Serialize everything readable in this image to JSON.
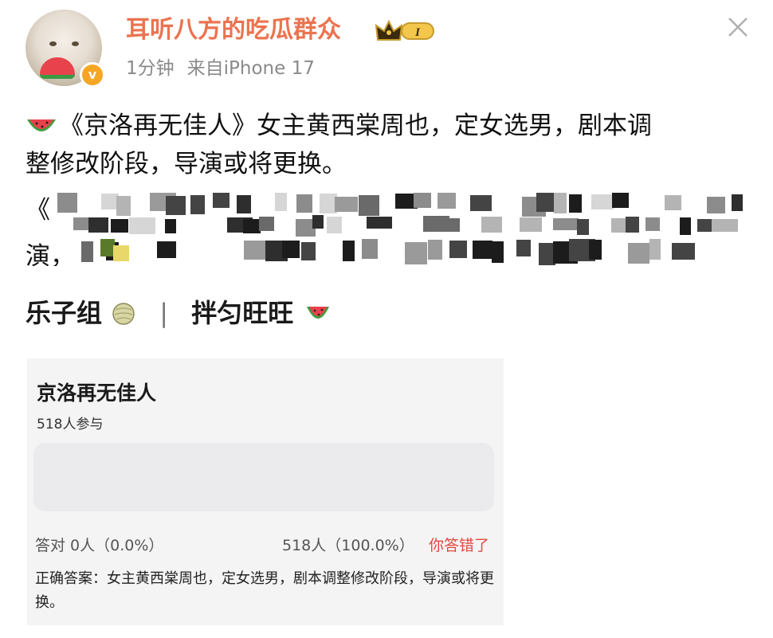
{
  "user": {
    "name": "耳听八方的吃瓜群众",
    "badge_level": "I",
    "time": "1分钟",
    "source": "来自iPhone 17"
  },
  "post": {
    "line1": "《京洛再无佳人》女主黄西棠周也，定女选男，剧本调",
    "line2": "整修改阶段，导演或将更换。",
    "blurred_visible_start": "《",
    "blurred_visible_line2": "演，"
  },
  "subheader": {
    "left": "乐子组",
    "separator": "|",
    "right": "拌匀旺旺"
  },
  "quiz": {
    "title": "京洛再无佳人",
    "participants": "518人参与",
    "correct_stat": "答对  0人（0.0%）",
    "wrong_stat": "518人（100.0%）",
    "wrong_label": "你答错了",
    "answer": "正确答案：女主黄西棠周也，定女选男，剧本调整修改阶段，导演或将更换。",
    "result_share": 1.0
  },
  "colors": {
    "username": "#eb7350",
    "badge": "#f5a623",
    "wrong": "#e2483d"
  },
  "icons": [
    "avatar",
    "verified-badge-icon",
    "crown-level-icon",
    "close-icon",
    "watermelon-icon",
    "melon-ball-icon"
  ]
}
